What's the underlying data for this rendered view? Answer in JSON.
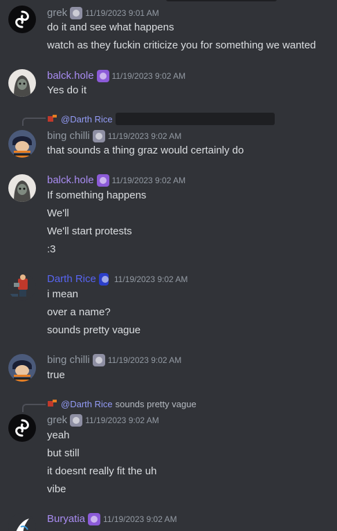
{
  "colors": {
    "background": "#313338",
    "text": "#dbdee1",
    "muted": "#949ba4",
    "grek": "#949ba4",
    "balck": "#a98cf2",
    "bing": "#949ba4",
    "darth": "#5865f2",
    "buryatia": "#a98cf2",
    "mention": "#949cf7"
  },
  "messages": [
    {
      "username": "grek",
      "badge_icon": "nitro-gem-icon",
      "timestamp": "11/19/2023 9:01 AM",
      "lines": [
        "do it and see what happens",
        "watch as they fuckin criticize you for something we wanted"
      ]
    },
    {
      "username": "balck.hole",
      "badge_icon": "purple-orb-icon",
      "timestamp": "11/19/2023 9:02 AM",
      "lines": [
        "Yes do it"
      ]
    },
    {
      "reply_to": "@Darth Rice",
      "username": "bing chilli",
      "badge_icon": "nitro-gem-icon",
      "timestamp": "11/19/2023 9:02 AM",
      "lines": [
        "that sounds a thing graz would certainly do"
      ]
    },
    {
      "username": "balck.hole",
      "badge_icon": "purple-orb-icon",
      "timestamp": "11/19/2023 9:02 AM",
      "lines": [
        "If something happens",
        "We'll",
        "We'll start protests",
        ":3"
      ]
    },
    {
      "username": "Darth Rice",
      "badge_icon": "blue-can-icon",
      "timestamp": "11/19/2023 9:02 AM",
      "lines": [
        "i mean",
        "over a name?",
        "sounds pretty vague"
      ]
    },
    {
      "username": "bing chilli",
      "badge_icon": "nitro-gem-icon",
      "timestamp": "11/19/2023 9:02 AM",
      "lines": [
        "true"
      ]
    },
    {
      "reply_to": "@Darth Rice",
      "reply_text": "sounds pretty vague",
      "username": "grek",
      "badge_icon": "nitro-gem-icon",
      "timestamp": "11/19/2023 9:02 AM",
      "lines": [
        "yeah",
        "but still",
        "it doesnt really fit the uh",
        "vibe"
      ]
    },
    {
      "username": "Buryatia",
      "badge_icon": "purple-orb-icon",
      "timestamp": "11/19/2023 9:02 AM",
      "lines": []
    }
  ]
}
